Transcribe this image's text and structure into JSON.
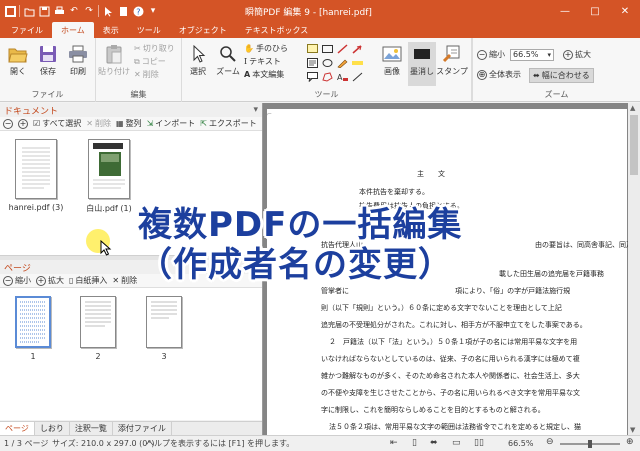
{
  "window": {
    "title": "瞬簡PDF 編集 9 - [hanrei.pdf]",
    "controls": [
      "—",
      "□",
      "✕"
    ]
  },
  "colors": {
    "accent": "#d45426",
    "active_tab_text": "#c44a1e",
    "overlay_text": "#1c3f9e"
  },
  "menu_tabs": [
    "ファイル",
    "ホーム",
    "表示",
    "ツール",
    "オブジェクト",
    "テキストボックス"
  ],
  "active_tab": "ホーム",
  "ribbon": {
    "file_group": {
      "label": "ファイル",
      "open": "開く",
      "save": "保存",
      "print": "印刷"
    },
    "edit_group": {
      "label": "編集",
      "paste": "貼り付け",
      "cut": "切り取り",
      "copy": "コピー",
      "delete": "削除"
    },
    "select": "選択",
    "zoom_tool": "ズーム",
    "hand_tool": "手のひら",
    "text_tool": "テキスト",
    "text_edit": "本文編集",
    "tools_label": "ツール",
    "image": "画像",
    "redact": "墨消し",
    "stamp": "スタンプ",
    "zoom_group": {
      "label": "ズーム",
      "zoom_out": "縮小",
      "zoom_value": "66.5%",
      "zoom_in": "拡大",
      "fit_page": "全体表示",
      "fit_width": "幅に合わせる"
    }
  },
  "document_panel": {
    "title": "ドキュメント",
    "toolbar": {
      "select_all": "すべて選択",
      "delete": "削除",
      "arrange": "整列",
      "import": "インポート",
      "export": "エクスポート"
    },
    "documents": [
      {
        "name": "hanrei.pdf (3)"
      },
      {
        "name": "白山.pdf (1)"
      }
    ]
  },
  "page_panel": {
    "title": "ページ",
    "toolbar": {
      "zoom_out": "縮小",
      "zoom_in": "拡大",
      "insert_blank": "白紙挿入",
      "delete": "削除"
    },
    "pages": [
      "1",
      "2",
      "3"
    ]
  },
  "bottom_tabs": [
    "ページ",
    "しおり",
    "注釈一覧",
    "添付ファイル"
  ],
  "document_text": {
    "heading": "主　　文",
    "line1": "本件抗告を棄却する。",
    "line2": "抗告費用は抗告人の負担とする。",
    "line3": "抗告代理人山",
    "line3_right": "抗告理由第1点について",
    "line3_tail": "由の要旨は、同高舎事記、同及",
    "line4": "び通信",
    "line4_tail": "載した田生届の追完届を戸籍事務",
    "line5": "管掌者に",
    "line5_tail": "項により、「俗」の字が戸籍法施行規",
    "line6": "則（以下「規則」という。）６０条に定める文字でないことを理由として上記",
    "line7": "追完届の不受理処分がされた。これに対し、相手方が不服申立てをした事案である。",
    "line8": "２　戸籍法（以下「法」という。）５０条１項が子の名には常用平易な文字を用",
    "line9": "いなければならないとしているのは、従来、子の名に用いられる漢字には極めて複",
    "line10": "雑かつ難解なものが多く、そのため命名された本人や関係者に、社会生活上、多大",
    "line11": "の不便や支障を生じさせたことから、子の名に用いられるべき文字を常用平易な文",
    "line12": "字に制限し、これを簡明ならしめることを目的とするものと解される。",
    "line13": "法５０条２項は、常用平易な文字の範囲は法務省令でこれを定めると規定し、猫"
  },
  "overlay": {
    "line1": "複数PDFの一括編集",
    "line2": "（作成者名の変更）"
  },
  "status": {
    "page": "1 / 3 ページ",
    "size": "サイズ: 210.0 x 297.0 (0°)",
    "help": "ヘルプを表示するには [F1] を押します。",
    "zoom": "66.5%",
    "zoom_level_fraction": 0.5
  }
}
